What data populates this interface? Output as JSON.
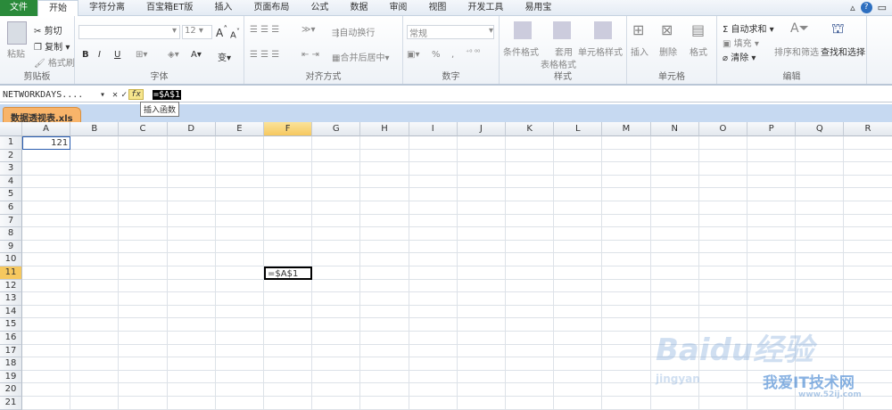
{
  "tabs": [
    "文件",
    "开始",
    "字符分离",
    "百宝箱ET版",
    "插入",
    "页面布局",
    "公式",
    "数据",
    "审阅",
    "视图",
    "开发工具",
    "易用宝"
  ],
  "ribbon": {
    "clipboard": {
      "paste": "粘贴",
      "cut": "剪切",
      "copy": "复制",
      "format_painter": "格式刷",
      "label": "剪贴板"
    },
    "font": {
      "size": "12",
      "label": "字体",
      "bold": "B",
      "italic": "I",
      "underline": "U"
    },
    "align": {
      "wrap": "自动换行",
      "merge": "合并后居中",
      "label": "对齐方式"
    },
    "number": {
      "format": "常规",
      "percent": "%",
      "comma": ",",
      "label": "数字"
    },
    "styles": {
      "conditional": "条件格式",
      "table1": "套用",
      "table2": "表格格式",
      "cell_style": "单元格样式",
      "label": "样式"
    },
    "cells": {
      "insert": "插入",
      "delete": "删除",
      "format": "格式",
      "label": "单元格"
    },
    "editing": {
      "autosum": "自动求和",
      "fill": "填充",
      "clear": "清除",
      "sort": "排序和筛选",
      "find": "查找和选择",
      "label": "编辑"
    }
  },
  "formula_bar": {
    "name_box": "NETWORKDAYS....",
    "cancel": "✕",
    "enter": "✓",
    "fx": "fx",
    "formula": "=$A$1",
    "tooltip": "插入函数"
  },
  "workbook_tab": "数据透视表.xls",
  "columns": [
    "A",
    "B",
    "C",
    "D",
    "E",
    "F",
    "G",
    "H",
    "I",
    "J",
    "K",
    "L",
    "M",
    "N",
    "O",
    "P",
    "Q",
    "R"
  ],
  "rows": 21,
  "active_column": "F",
  "active_row": 11,
  "cells": {
    "A1": "121",
    "F11": "=$A$1"
  },
  "watermark": {
    "brand": "Baidu经验",
    "site": "我爱IT技术网",
    "url": "www.52ij.com",
    "sub": "jingyan"
  }
}
